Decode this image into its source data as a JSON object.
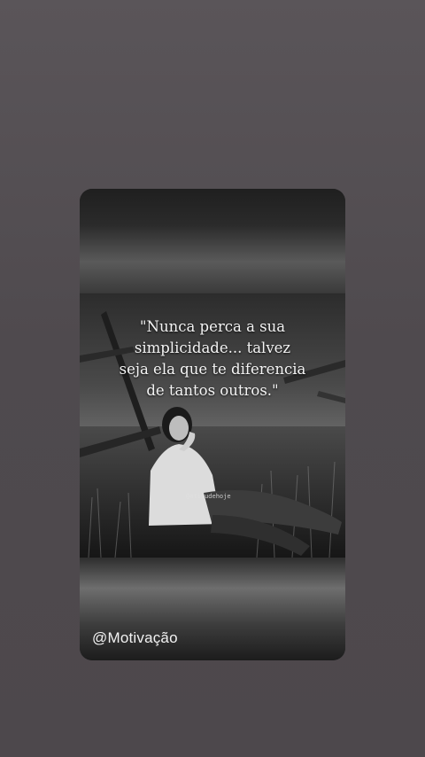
{
  "story": {
    "quote_lines": [
      "\"Nunca perca a sua",
      "simplicidade... talvez",
      "seja ela que te diferencia",
      "de tantos outros.\""
    ],
    "watermark": "@atitudehoje",
    "author": "@Motivação"
  },
  "colors": {
    "page_background": "#4f4a4e",
    "text": "#f4f4f4"
  }
}
